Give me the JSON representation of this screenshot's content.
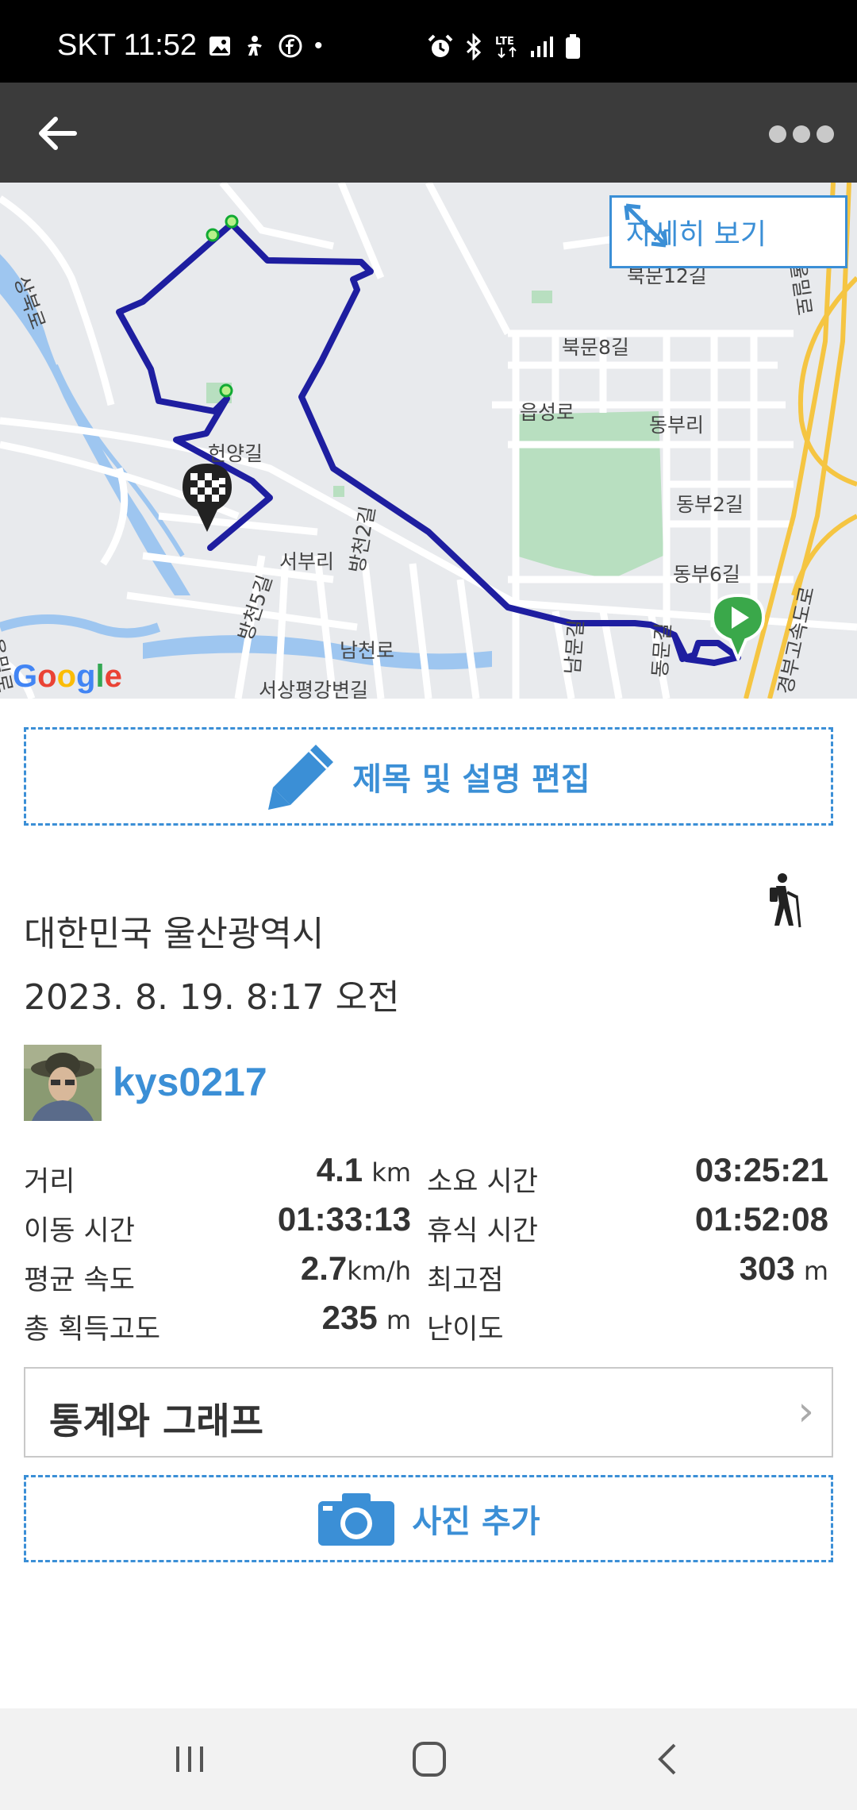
{
  "status_bar": {
    "carrier_time": "SKT 11:52",
    "left_icons": [
      "image-icon",
      "accessibility-icon",
      "facebook-icon",
      "dot-icon"
    ],
    "right_icons": [
      "alarm-icon",
      "bluetooth-icon",
      "lte-icon",
      "signal-icon",
      "battery-icon"
    ],
    "lte": "LTE"
  },
  "app_bar": {
    "back_icon": "back-arrow-icon",
    "more_icon": "more-dots-icon"
  },
  "map": {
    "detail_button_label": "자세히 보기",
    "labels": [
      "북문12길",
      "북문8길",
      "읍성로",
      "동부리",
      "동부2길",
      "동부6길",
      "헌양길",
      "서부리",
      "방천2길",
      "방천5길",
      "남천로",
      "서상평강변길",
      "남문길",
      "동문길",
      "상북로",
      "울밀로",
      "경부고속도로",
      "울밀로"
    ],
    "google": "Google",
    "colors": {
      "track": "#1e1ea0",
      "park": "#b8dfc0",
      "water": "#9ec6f0",
      "highway": "#f5c542",
      "road": "#ffffff"
    }
  },
  "edit_button": {
    "label": "제목 및 설명 편집",
    "icon": "pencil-icon"
  },
  "trip": {
    "location": "대한민국 울산광역시",
    "datetime": "2023. 8. 19. 8:17 오전",
    "activity_icon": "hiking-icon",
    "username": "kys0217"
  },
  "stats": [
    {
      "label": "거리",
      "value": "4.1",
      "unit": "km",
      "label2": "소요 시간",
      "value2": "03:25:21",
      "unit2": ""
    },
    {
      "label": "이동 시간",
      "value": "01:33:13",
      "unit": "",
      "label2": "휴식 시간",
      "value2": "01:52:08",
      "unit2": ""
    },
    {
      "label": "평균 속도",
      "value": "2.7",
      "unit": "km/h",
      "label2": "최고점",
      "value2": "303",
      "unit2": "m"
    },
    {
      "label": "총 획득고도",
      "value": "235",
      "unit": "m",
      "label2": "난이도",
      "value2": "",
      "unit2": ""
    }
  ],
  "graph_button": {
    "label": "통계와 그래프",
    "chevron": "›"
  },
  "photo_button": {
    "label": "사진 추가",
    "icon": "camera-icon"
  },
  "nav_bar": {
    "icons": [
      "recent-apps-icon",
      "home-icon",
      "nav-back-icon"
    ]
  },
  "accent_color": "#3b8fd6"
}
